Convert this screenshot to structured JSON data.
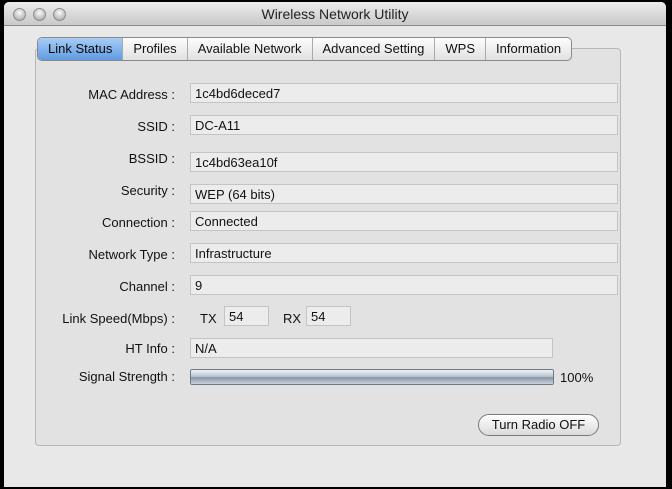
{
  "window": {
    "title": "Wireless Network Utility"
  },
  "tabs": [
    {
      "label": "Link Status",
      "active": true
    },
    {
      "label": "Profiles"
    },
    {
      "label": "Available Network"
    },
    {
      "label": "Advanced Setting"
    },
    {
      "label": "WPS"
    },
    {
      "label": "Information"
    }
  ],
  "status": {
    "mac_label": "MAC Address :",
    "mac_value": "1c4bd6deced7",
    "ssid_label": "SSID :",
    "ssid_value": "DC-A11",
    "bssid_label": "BSSID :",
    "bssid_value": "1c4bd63ea10f",
    "security_label": "Security :",
    "security_value": "WEP (64 bits)",
    "connection_label": "Connection :",
    "connection_value": "Connected",
    "network_type_label": "Network Type :",
    "network_type_value": "Infrastructure",
    "channel_label": "Channel :",
    "channel_value": "9",
    "link_speed_label": "Link Speed(Mbps) :",
    "tx_label": "TX",
    "tx_value": "54",
    "rx_label": "RX",
    "rx_value": "54",
    "ht_info_label": "HT Info :",
    "ht_info_value": "N/A",
    "signal_label": "Signal Strength :",
    "signal_percent": 100,
    "signal_text": "100%"
  },
  "buttons": {
    "turn_radio": "Turn Radio OFF"
  }
}
